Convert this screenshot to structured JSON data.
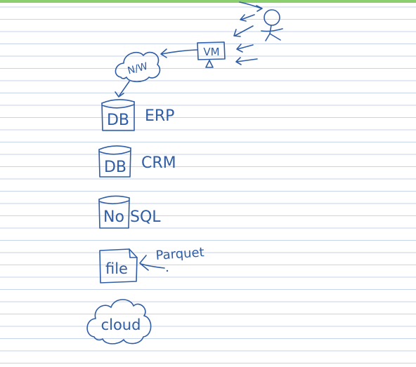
{
  "colors": {
    "ink": "#2f5da6",
    "ruled_line": "#c7d3ea",
    "top_bar": "#8ccf6e",
    "paper": "#ffffff"
  },
  "labels": {
    "vm": "VM",
    "network": "N/W",
    "db_erp": "DB",
    "erp": "ERP",
    "db_crm": "DB",
    "crm": "CRM",
    "nosql_no": "No",
    "nosql_sql": "SQL",
    "file": "file",
    "parquet": "Parquet",
    "cloud": "cloud"
  }
}
